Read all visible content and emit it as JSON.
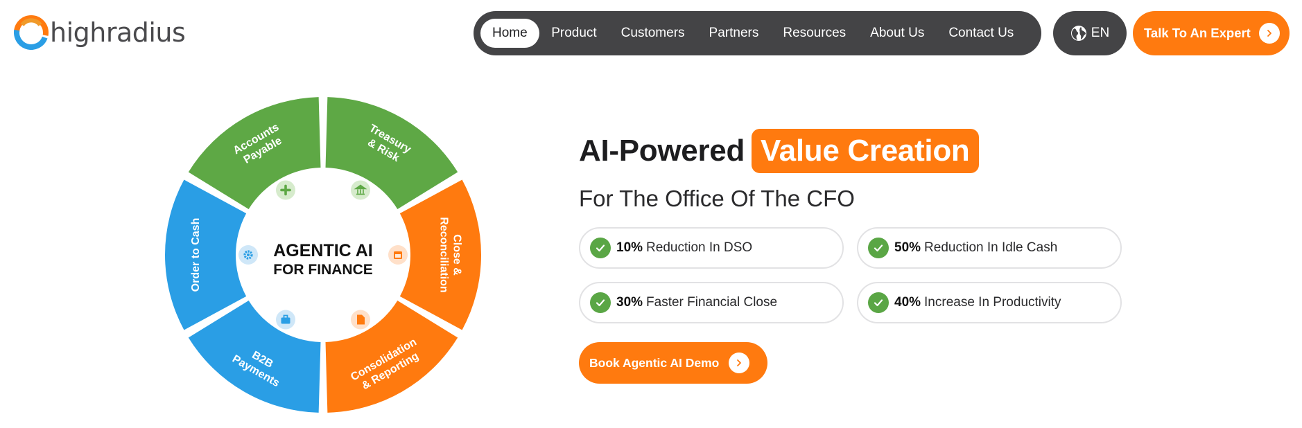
{
  "brand": {
    "name": "highradius",
    "colors": {
      "orange": "#ff7a0f",
      "blue": "#2a9ee5",
      "green": "#5ea845",
      "nav": "#444446"
    }
  },
  "nav": {
    "items": [
      {
        "label": "Home",
        "active": true
      },
      {
        "label": "Product"
      },
      {
        "label": "Customers"
      },
      {
        "label": "Partners"
      },
      {
        "label": "Resources"
      },
      {
        "label": "About Us"
      },
      {
        "label": "Contact Us"
      }
    ],
    "language": {
      "label": "EN",
      "icon": "globe-icon"
    },
    "cta": {
      "label": "Talk To An Expert",
      "icon": "chevron-right-icon"
    }
  },
  "wheel": {
    "center_line1": "AGENTIC AI",
    "center_line2": "FOR FINANCE",
    "segments": [
      {
        "lines": [
          "Order to Cash"
        ],
        "color": "#2a9ee5",
        "icon": "gear-icon"
      },
      {
        "lines": [
          "Accounts",
          "Payable"
        ],
        "color": "#5ea845",
        "icon": "plus-icon"
      },
      {
        "lines": [
          "Treasury",
          "& Risk"
        ],
        "color": "#5ea845",
        "icon": "bank-icon"
      },
      {
        "lines": [
          "Close &",
          "Reconciliation"
        ],
        "color": "#ff7a0f",
        "icon": "calendar-icon"
      },
      {
        "lines": [
          "Consolidation",
          "& Reporting"
        ],
        "color": "#ff7a0f",
        "icon": "document-icon"
      },
      {
        "lines": [
          "B2B",
          "Payments"
        ],
        "color": "#2a9ee5",
        "icon": "briefcase-icon"
      }
    ]
  },
  "hero": {
    "title": "AI-Powered",
    "highlight": "Value Creation",
    "subtitle": "For The Office Of The CFO",
    "stats": [
      {
        "value": "10%",
        "text": "Reduction In DSO"
      },
      {
        "value": "50%",
        "text": "Reduction In Idle Cash"
      },
      {
        "value": "30%",
        "text": "Faster Financial Close"
      },
      {
        "value": "40%",
        "text": "Increase In Productivity"
      }
    ],
    "cta": {
      "label": "Book Agentic AI Demo",
      "icon": "chevron-right-icon"
    }
  }
}
